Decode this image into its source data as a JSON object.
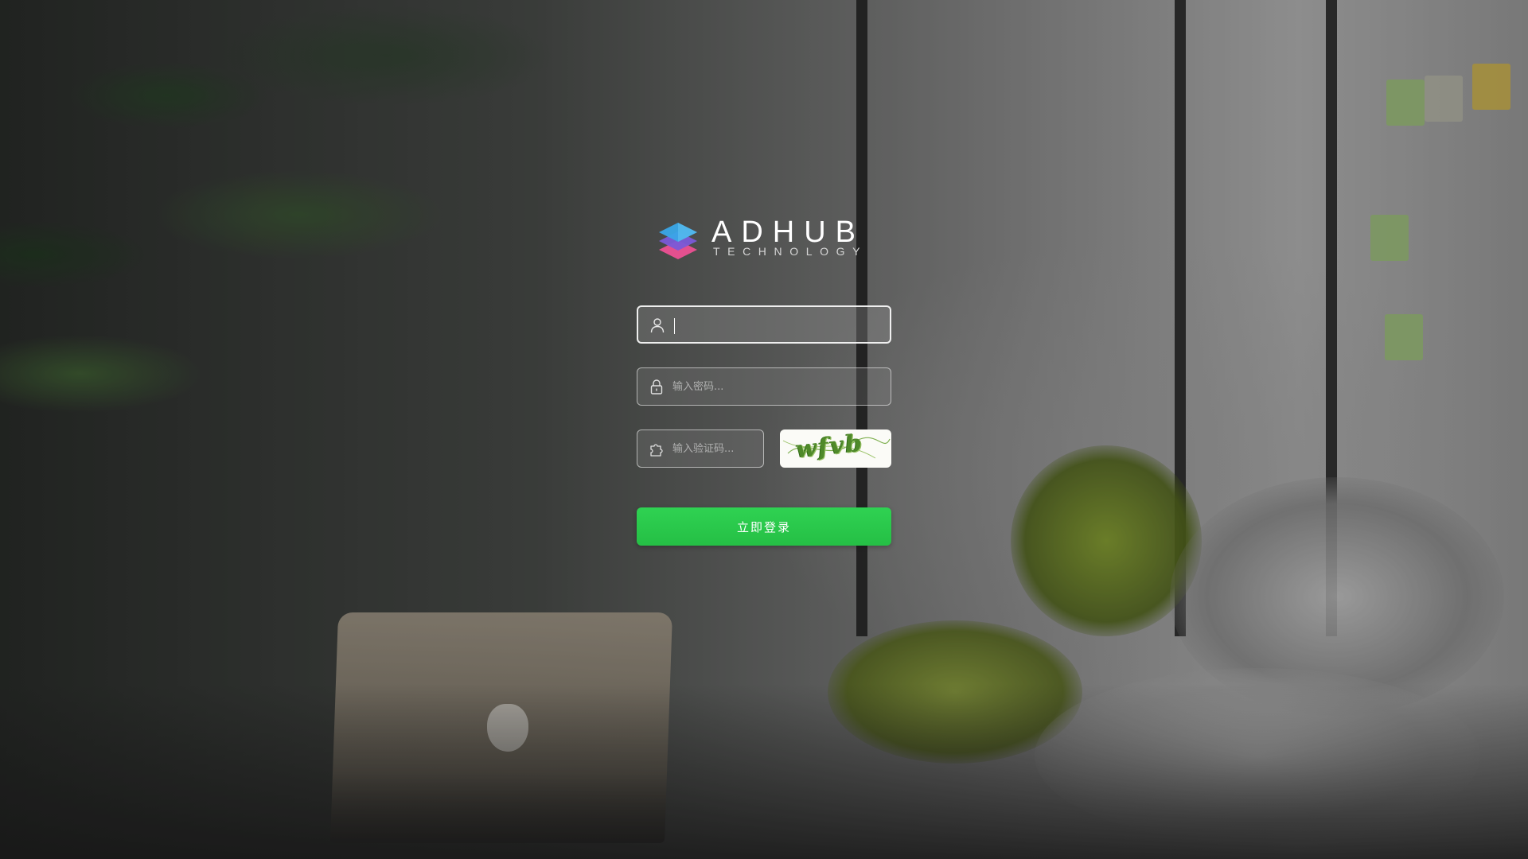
{
  "brand": {
    "name": "ADHUB",
    "tagline": "TECHNOLOGY"
  },
  "form": {
    "username": {
      "value": "",
      "placeholder": "",
      "icon": "user-icon"
    },
    "password": {
      "value": "",
      "placeholder": "输入密码...",
      "icon": "lock-icon"
    },
    "captcha": {
      "value": "",
      "placeholder": "输入验证码...",
      "icon": "puzzle-icon",
      "image_text": "wfvb"
    },
    "submit_label": "立即登录"
  },
  "colors": {
    "submit": "#28c84a",
    "logo_blue": "#3aa7e8",
    "logo_purple": "#7a5ad8",
    "logo_pink": "#e4508f"
  }
}
